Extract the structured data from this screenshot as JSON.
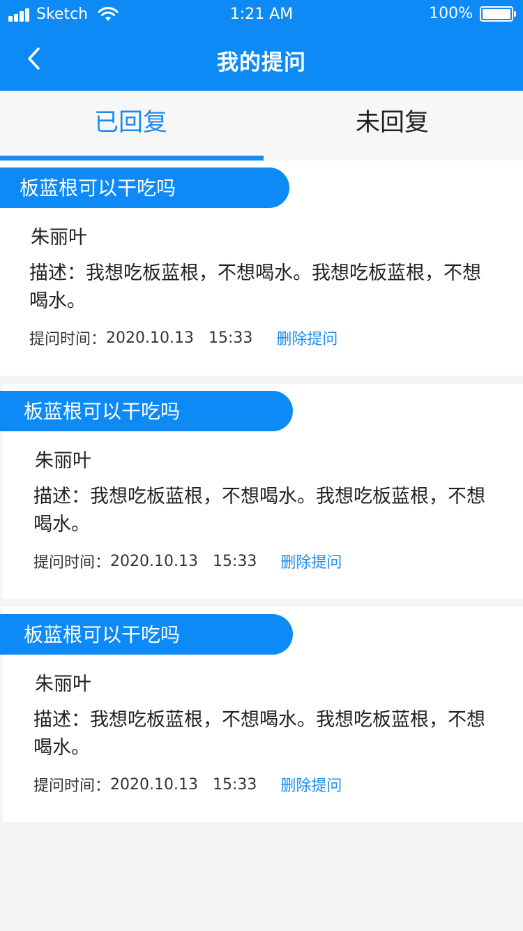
{
  "status_bar": {
    "carrier": "Sketch",
    "time": "1:21 AM",
    "battery": "100%"
  },
  "nav": {
    "title": "我的提问",
    "back_icon": "chevron-left-icon"
  },
  "tabs": [
    {
      "label": "已回复",
      "active": true
    },
    {
      "label": "未回复",
      "active": false
    }
  ],
  "questions": [
    {
      "title": "板蓝根可以干吃吗",
      "user": "朱丽叶",
      "description": "描述：我想吃板蓝根，不想喝水。我想吃板蓝根，不想喝水。",
      "time_label": "提问时间：",
      "time": "2020.10.13   15:33",
      "delete_label": "删除提问"
    },
    {
      "title": "板蓝根可以干吃吗",
      "user": "朱丽叶",
      "description": "描述：我想吃板蓝根，不想喝水。我想吃板蓝根，不想喝水。",
      "time_label": "提问时间：",
      "time": "2020.10.13   15:33",
      "delete_label": "删除提问"
    },
    {
      "title": "板蓝根可以干吃吗",
      "user": "朱丽叶",
      "description": "描述：我想吃板蓝根，不想喝水。我想吃板蓝根，不想喝水。",
      "time_label": "提问时间：",
      "time": "2020.10.13   15:33",
      "delete_label": "删除提问"
    }
  ],
  "colors": {
    "brand": "#0e8af7",
    "accent": "#1a8cf0",
    "background": "#f5f5f5"
  }
}
